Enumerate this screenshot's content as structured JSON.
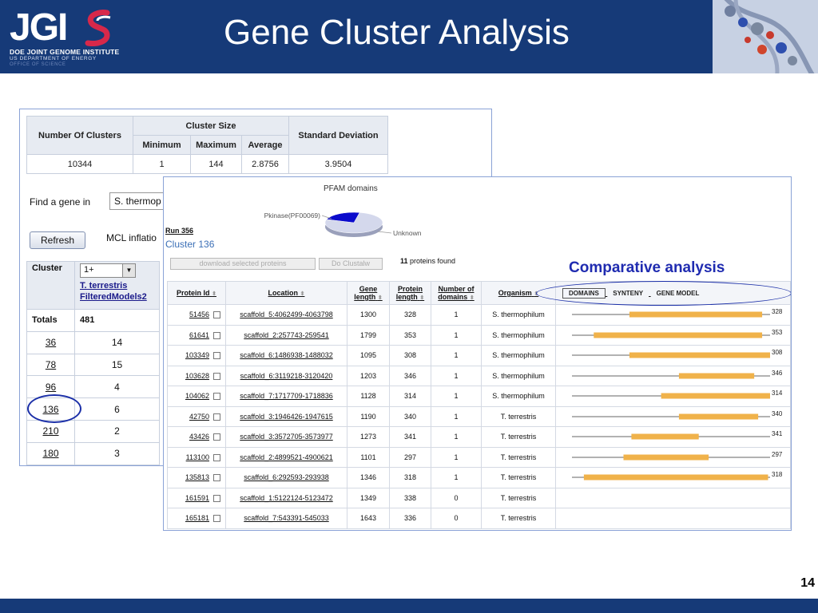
{
  "slide": {
    "title": "Gene Cluster Analysis",
    "slide_number": "14",
    "logo": {
      "wordmark": "JGI",
      "line1": "DOE JOINT GENOME INSTITUTE",
      "line2": "US DEPARTMENT OF ENERGY",
      "line3": "OFFICE OF SCIENCE"
    }
  },
  "stats_table": {
    "headers": {
      "number_of_clusters": "Number Of Clusters",
      "cluster_size": "Cluster Size",
      "minimum": "Minimum",
      "maximum": "Maximum",
      "average": "Average",
      "std_dev": "Standard Deviation"
    },
    "values": {
      "number_of_clusters": "10344",
      "minimum": "1",
      "maximum": "144",
      "average": "2.8756",
      "std_dev": "3.9504"
    }
  },
  "controls": {
    "find_label": "Find a gene in",
    "find_select_value": "S. thermop",
    "refresh_label": "Refresh",
    "mcl_label": "MCL inflatio"
  },
  "cluster_table": {
    "header_cluster": "Cluster",
    "filter_value": "1+",
    "species_line1": "T. terrestris",
    "species_line2": "FilteredModels2",
    "totals_label": "Totals",
    "totals_value": "481",
    "rows": [
      {
        "cluster": "36",
        "count": "14"
      },
      {
        "cluster": "78",
        "count": "15"
      },
      {
        "cluster": "96",
        "count": "4"
      },
      {
        "cluster": "136",
        "count": "6"
      },
      {
        "cluster": "210",
        "count": "2"
      },
      {
        "cluster": "180",
        "count": "3"
      }
    ]
  },
  "detail_panel": {
    "pfam_title": "PFAM domains",
    "pie": {
      "slices": [
        {
          "label": "Pkinase(PF00069)",
          "fraction": 0.77,
          "color": "#d4d8ec"
        },
        {
          "label": "Unknown",
          "fraction": 0.23,
          "color": "#0b0bcc"
        }
      ]
    },
    "run_label": "Run 356",
    "cluster_heading": "Cluster 136",
    "download_label": "download selected proteins",
    "clustalw_label": "Do Clustalw",
    "found_count": "11",
    "found_suffix": " proteins found",
    "comparative_label": "Comparative analysis",
    "columns": {
      "protein_id": "Protein Id",
      "location": "Location",
      "gene_length": "Gene length",
      "protein_length": "Protein length",
      "num_domains": "Number of domains",
      "organism": "Organism"
    },
    "view_tabs": [
      "DOMAINS",
      "SYNTENY",
      "GENE MODEL"
    ],
    "proteins": [
      {
        "id": "51456",
        "location": "scaffold_5:4062499-4063798",
        "gene_length": "1300",
        "protein_length": "328",
        "domains": "1",
        "organism": "S. thermophilum",
        "domain_start": 0.29,
        "domain_end": 0.96
      },
      {
        "id": "61641",
        "location": "scaffold_2:257743-259541",
        "gene_length": "1799",
        "protein_length": "353",
        "domains": "1",
        "organism": "S. thermophilum",
        "domain_start": 0.11,
        "domain_end": 0.96
      },
      {
        "id": "103349",
        "location": "scaffold_6:1486938-1488032",
        "gene_length": "1095",
        "protein_length": "308",
        "domains": "1",
        "organism": "S. thermophilum",
        "domain_start": 0.29,
        "domain_end": 1.0
      },
      {
        "id": "103628",
        "location": "scaffold_6:3119218-3120420",
        "gene_length": "1203",
        "protein_length": "346",
        "domains": "1",
        "organism": "S. thermophilum",
        "domain_start": 0.54,
        "domain_end": 0.92
      },
      {
        "id": "104062",
        "location": "scaffold_7:1717709-1718836",
        "gene_length": "1128",
        "protein_length": "314",
        "domains": "1",
        "organism": "S. thermophilum",
        "domain_start": 0.45,
        "domain_end": 1.0
      },
      {
        "id": "42750",
        "location": "scaffold_3:1946426-1947615",
        "gene_length": "1190",
        "protein_length": "340",
        "domains": "1",
        "organism": "T. terrestris",
        "domain_start": 0.54,
        "domain_end": 0.94
      },
      {
        "id": "43426",
        "location": "scaffold_3:3572705-3573977",
        "gene_length": "1273",
        "protein_length": "341",
        "domains": "1",
        "organism": "T. terrestris",
        "domain_start": 0.3,
        "domain_end": 0.64
      },
      {
        "id": "113100",
        "location": "scaffold_2:4899521-4900621",
        "gene_length": "1101",
        "protein_length": "297",
        "domains": "1",
        "organism": "T. terrestris",
        "domain_start": 0.26,
        "domain_end": 0.69
      },
      {
        "id": "135813",
        "location": "scaffold_6:292593-293938",
        "gene_length": "1346",
        "protein_length": "318",
        "domains": "1",
        "organism": "T. terrestris",
        "domain_start": 0.06,
        "domain_end": 0.99
      },
      {
        "id": "161591",
        "location": "scaffold_1:5122124-5123472",
        "gene_length": "1349",
        "protein_length": "338",
        "domains": "0",
        "organism": "T. terrestris",
        "domain_start": null,
        "domain_end": null
      },
      {
        "id": "165181",
        "location": "scaffold_7:543391-545033",
        "gene_length": "1643",
        "protein_length": "336",
        "domains": "0",
        "organism": "T. terrestris",
        "domain_start": null,
        "domain_end": null
      }
    ]
  },
  "colors": {
    "header_bg": "#163a78",
    "accent_blue": "#1f2bb0",
    "domain_bar": "#f0b24a",
    "cluster_link": "#3b6fb6"
  }
}
